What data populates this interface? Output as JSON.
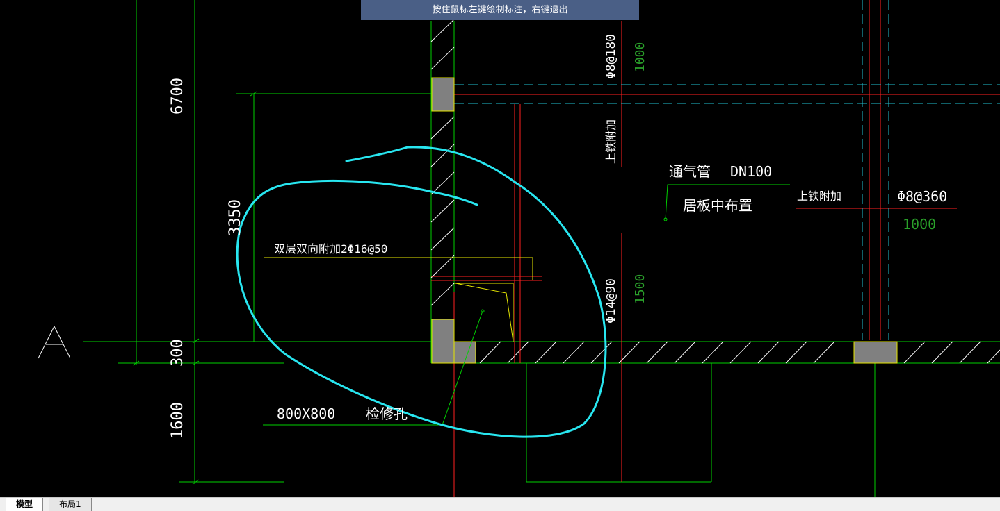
{
  "hint_bar": {
    "text": "按住鼠标左键绘制标注，右键退出"
  },
  "drawing": {
    "axis_label": "A",
    "dims_vertical": [
      "6700",
      "3350",
      "300",
      "1600"
    ],
    "rebar_top_right": "Φ8@180",
    "rebar_len_top": "1000",
    "label_upper_iron": "上铁附加",
    "vent_pipe": "通气管",
    "vent_pipe_size": "DN100",
    "placed_center": "居板中布置",
    "label_upper_iron_right": "上铁附加",
    "rebar_right": "Φ8@360",
    "rebar_len_right": "1000",
    "double_layer_note": "双层双向附加2Φ16@50",
    "rebar_mid": "Φ14@90",
    "rebar_len_mid": "1500",
    "opening_size": "800X800",
    "opening_name": "检修孔"
  },
  "colors": {
    "background": "#000000",
    "grid_green": "#00d000",
    "axis_red": "#ff2020",
    "dashed_cyan": "#20c0d0",
    "markup_cyan": "#28e6f0",
    "column_gray": "#808080",
    "yellow": "#e6e600",
    "text_white": "#ffffff",
    "dim_green_text": "#2aa02a"
  },
  "tabs": [
    {
      "label": "模型",
      "active": true
    },
    {
      "label": "布局1",
      "active": false
    }
  ]
}
